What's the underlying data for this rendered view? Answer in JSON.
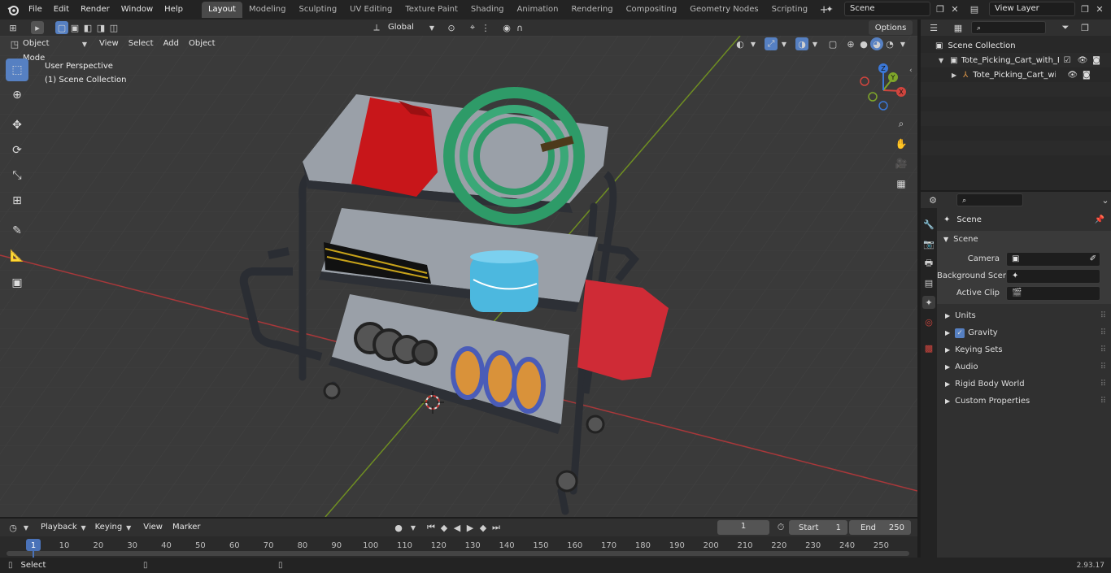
{
  "topbar": {
    "menus": [
      "File",
      "Edit",
      "Render",
      "Window",
      "Help"
    ],
    "workspaces": [
      "Layout",
      "Modeling",
      "Sculpting",
      "UV Editing",
      "Texture Paint",
      "Shading",
      "Animation",
      "Rendering",
      "Compositing",
      "Geometry Nodes",
      "Scripting"
    ],
    "active_workspace": "Layout",
    "scene_name": "Scene",
    "view_layer": "View Layer"
  },
  "viewport_header": {
    "mode": "Object Mode",
    "menus": [
      "View",
      "Select",
      "Add",
      "Object"
    ],
    "orientation": "Global",
    "options_label": "Options"
  },
  "viewport": {
    "perspective_label": "User Perspective",
    "collection_label": "(1) Scene Collection",
    "gizmo_axes": [
      "X",
      "Y",
      "Z"
    ]
  },
  "outliner": {
    "root": "Scene Collection",
    "items": [
      {
        "label": "Tote_Picking_Cart_with_Equip",
        "level": 1
      },
      {
        "label": "Tote_Picking_Cart_with_E",
        "level": 2
      }
    ]
  },
  "properties": {
    "breadcrumb": "Scene",
    "panel_title": "Scene",
    "fields": [
      {
        "label": "Camera",
        "value": ""
      },
      {
        "label": "Background Scene",
        "value": ""
      },
      {
        "label": "Active Clip",
        "value": ""
      }
    ],
    "subpanels": [
      "Units",
      "Gravity",
      "Keying Sets",
      "Audio",
      "Rigid Body World",
      "Custom Properties"
    ],
    "gravity_checked": true
  },
  "timeline": {
    "menus": [
      "Playback",
      "Keying",
      "View",
      "Marker"
    ],
    "current_frame": "1",
    "start_label": "Start",
    "start_value": "1",
    "end_label": "End",
    "end_value": "250",
    "ticks": [
      "1",
      "10",
      "20",
      "30",
      "40",
      "50",
      "60",
      "70",
      "80",
      "90",
      "100",
      "110",
      "120",
      "130",
      "140",
      "150",
      "160",
      "170",
      "180",
      "190",
      "200",
      "210",
      "220",
      "230",
      "240",
      "250"
    ]
  },
  "statusbar": {
    "left_label": "Select",
    "version": "2.93.17"
  },
  "colors": {
    "accent": "#5680c2",
    "axis_red": "#c0392b",
    "axis_green": "#7fa62a",
    "active_frame": "#4a72b8"
  }
}
